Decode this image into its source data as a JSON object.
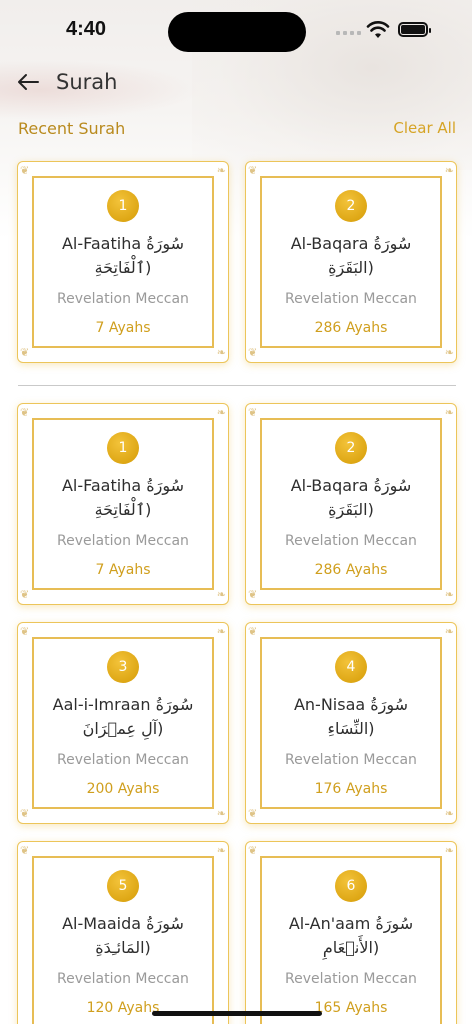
{
  "status_bar": {
    "time": "4:40"
  },
  "header": {
    "title": "Surah"
  },
  "recent": {
    "title": "Recent Surah",
    "clear_label": "Clear All"
  },
  "recent_cards": [
    {
      "number": "1",
      "name": "Al-Faatiha",
      "arabic_name": "سُورَةُ",
      "arabic": "(ٱلْفَاتِحَةِ",
      "revelation": "Revelation Meccan",
      "ayahs": "7  Ayahs"
    },
    {
      "number": "2",
      "name": "Al-Baqara",
      "arabic_name": "سُورَةُ",
      "arabic": "(البَقَرَةِ",
      "revelation": "Revelation Meccan",
      "ayahs": "286  Ayahs"
    }
  ],
  "surah_cards": [
    {
      "number": "1",
      "name": "Al-Faatiha",
      "arabic_name": "سُورَةُ",
      "arabic": "(ٱلْفَاتِحَةِ",
      "revelation": "Revelation Meccan",
      "ayahs": "7  Ayahs"
    },
    {
      "number": "2",
      "name": "Al-Baqara",
      "arabic_name": "سُورَةُ",
      "arabic": "(البَقَرَةِ",
      "revelation": "Revelation Meccan",
      "ayahs": "286  Ayahs"
    },
    {
      "number": "3",
      "name": "Aal-i-Imraan",
      "arabic_name": "سُورَةُ",
      "arabic": "(آلِ عِمۡرَانَ",
      "revelation": "Revelation Meccan",
      "ayahs": "200  Ayahs"
    },
    {
      "number": "4",
      "name": "An-Nisaa",
      "arabic_name": "سُورَةُ",
      "arabic": "(النِّسَاءِ",
      "revelation": "Revelation Meccan",
      "ayahs": "176  Ayahs"
    },
    {
      "number": "5",
      "name": "Al-Maaida",
      "arabic_name": "سُورَةُ",
      "arabic": "(المَائـِدَةِ",
      "revelation": "Revelation Meccan",
      "ayahs": "120  Ayahs"
    },
    {
      "number": "6",
      "name": "Al-An'aam",
      "arabic_name": "سُورَةُ",
      "arabic": "(الأَنۡعَامِ",
      "revelation": "Revelation Meccan",
      "ayahs": "165  Ayahs"
    }
  ],
  "colors": {
    "accent": "#d6a426",
    "card_border": "#ecc55a",
    "badge": "#dea715"
  },
  "icons": {
    "back": "arrow-left-icon",
    "wifi": "wifi-icon",
    "battery": "battery-icon",
    "signal": "signal-icon"
  }
}
